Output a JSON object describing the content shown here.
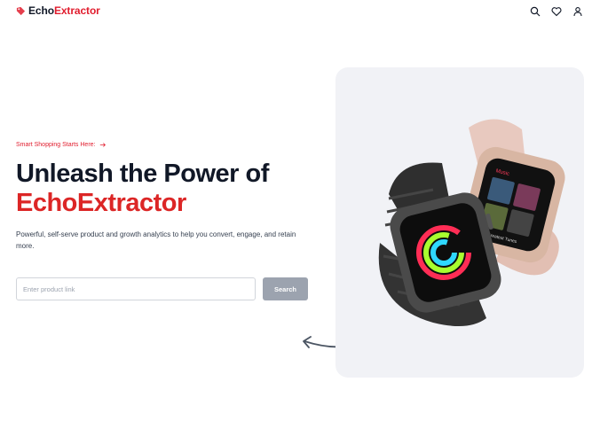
{
  "header": {
    "brand_part1": "Echo",
    "brand_part2": "Extractor",
    "icons": [
      "search-icon",
      "heart-icon",
      "user-icon"
    ]
  },
  "hero": {
    "eyebrow": "Smart Shopping Starts Here:",
    "title_line1": "Unleash the Power of",
    "title_line2": "EchoExtractor",
    "description": "Powerful, self-serve product and growth analytics to help you convert, engage, and retain more."
  },
  "search": {
    "placeholder": "Enter product link",
    "value": "",
    "button_label": "Search"
  },
  "product_image": {
    "alt": "Smart watches",
    "screen_label": "Music",
    "screen_caption": "Greatest Tunes"
  },
  "colors": {
    "accent": "#e11d2e",
    "title_dark": "#111827",
    "button_disabled": "#9ca3af",
    "panel_bg": "#f1f2f6"
  }
}
